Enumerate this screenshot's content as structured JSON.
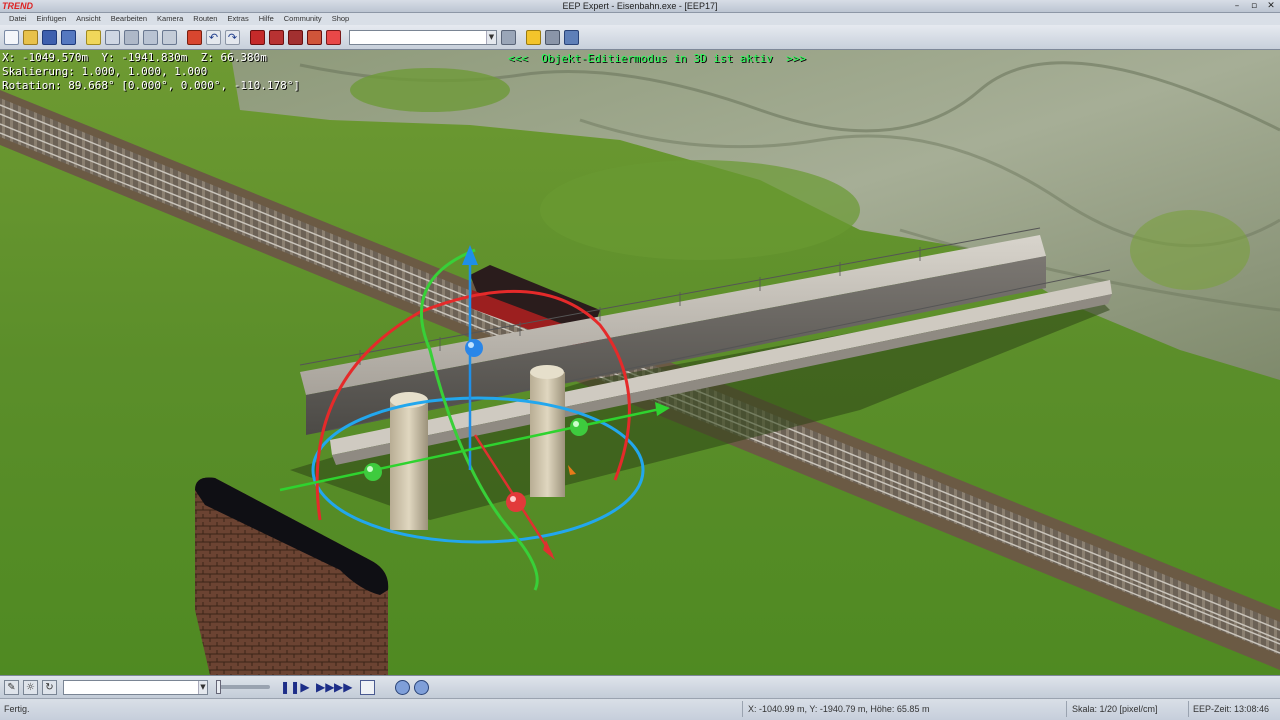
{
  "window": {
    "logo": "TREND",
    "title": "EEP Expert - Eisenbahn.exe - [EEP17]",
    "controls": [
      "–",
      "▫",
      "✕"
    ]
  },
  "menu": [
    "Datei",
    "Einfügen",
    "Ansicht",
    "Bearbeiten",
    "Kamera",
    "Routen",
    "Extras",
    "Hilfe",
    "Community",
    "Shop"
  ],
  "toolbar": {
    "object_combo_value": "",
    "icons": [
      "new-file-icon",
      "open-folder-icon",
      "save-icon",
      "save-as-icon",
      "layer-icon",
      "copy-icon",
      "tile-icon",
      "group-icon",
      "grid-icon",
      "signal-icon",
      "undo-icon",
      "redo-icon",
      "train-red-icon",
      "train-red2-icon",
      "train-red3-icon",
      "train-crane-icon",
      "flag-icon",
      "search-object-icon",
      "sun-icon",
      "tools-icon",
      "camera-icon"
    ]
  },
  "hud": {
    "position": "X: -1049.570m  Y: -1941.830m  Z: 66.380m",
    "scale": "Skalierung: 1.000, 1.000, 1.000",
    "rotation": "Rotation: 89.668° [0.000°, 0.000°, -110.178°]",
    "mode": "<<<  Objekt-Editiermodus in 3D ist aktiv  >>>"
  },
  "controls": {
    "combo_value": "",
    "slider_level": 0,
    "buttons": [
      "pause-icon",
      "play-icon",
      "fast-forward-icon",
      "faster-forward-icon",
      "screen-icon",
      "zoom-in-icon",
      "zoom-out-icon"
    ]
  },
  "status": {
    "left": "Fertig.",
    "coords": "X: -1040.99 m, Y: -1940.79 m, Höhe: 65.85 m",
    "scale": "Skala: 1/20 [pixel/cm]",
    "time": "EEP-Zeit: 13:08:46"
  }
}
